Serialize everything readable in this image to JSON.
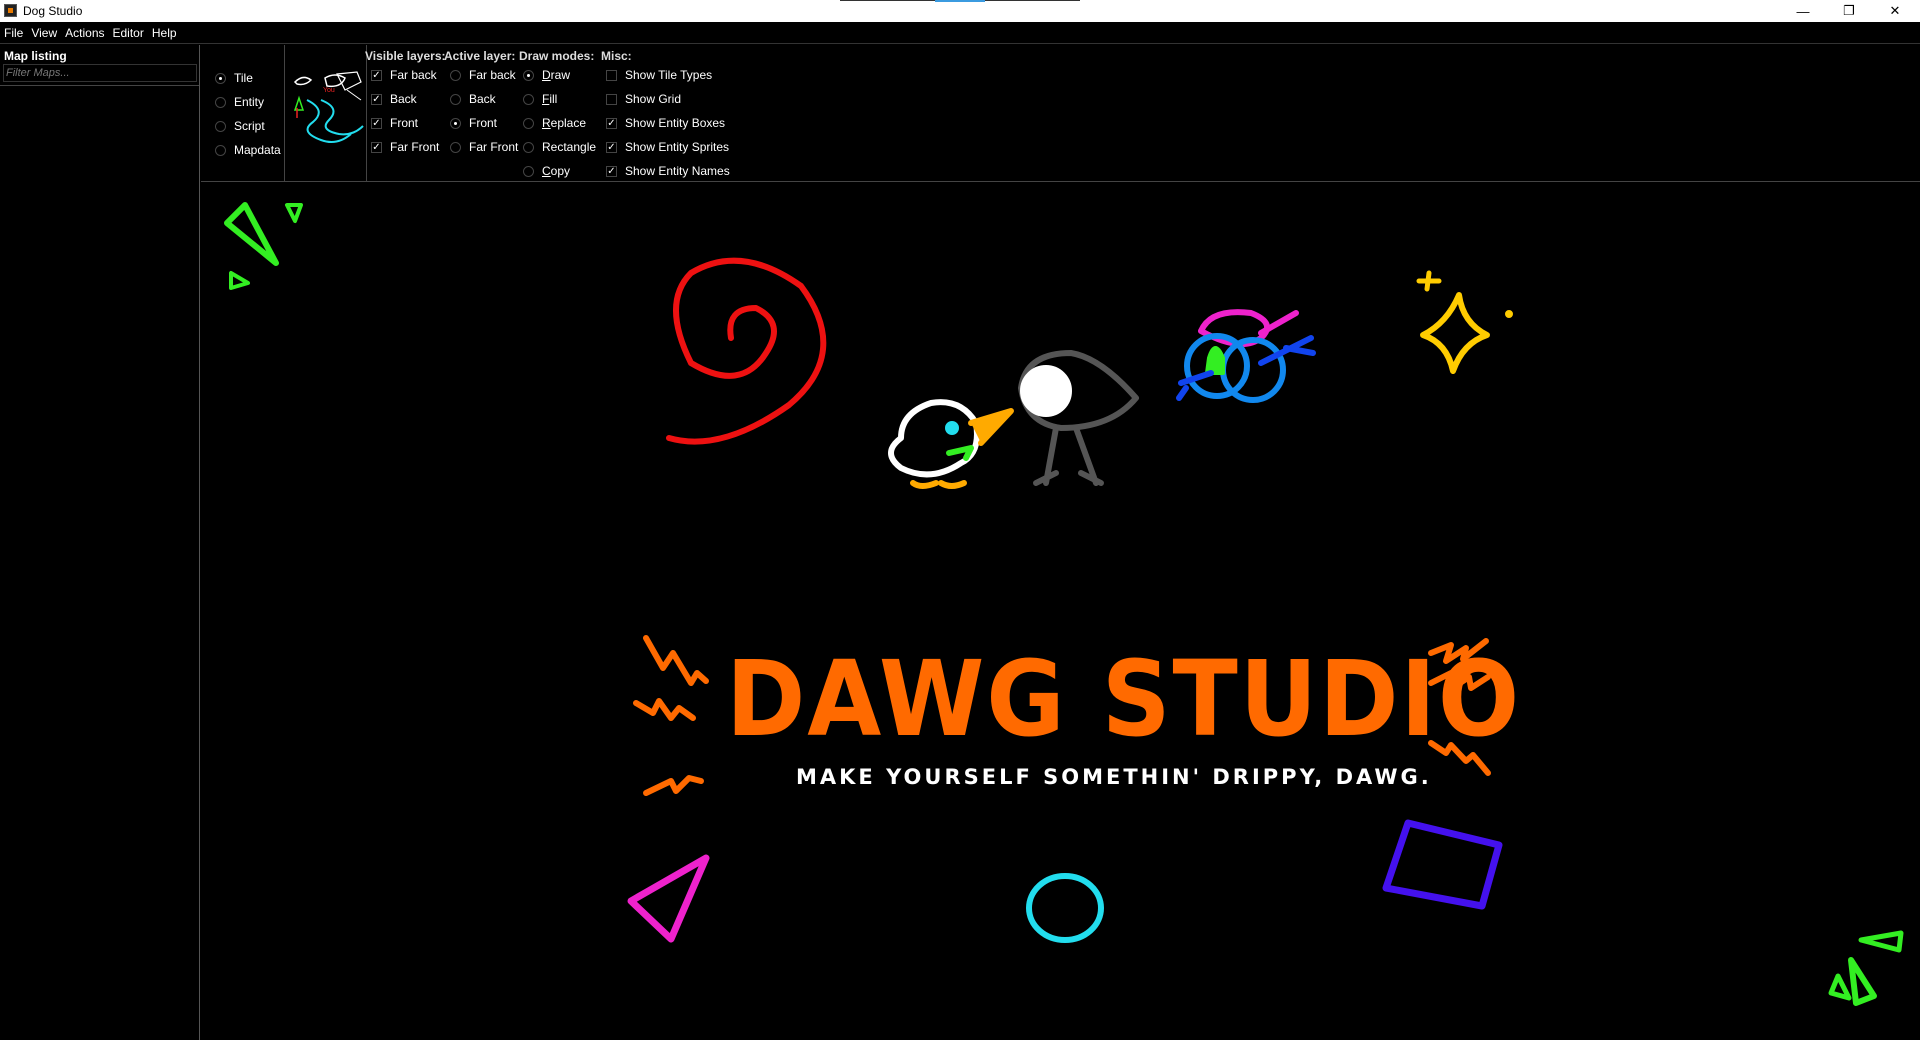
{
  "window": {
    "title": "Dog Studio",
    "icons": {
      "app": "app-icon",
      "minimize": "minimize-icon",
      "maximize": "restore-icon",
      "close": "close-icon"
    },
    "controls": {
      "minimize": "—",
      "maximize": "❐",
      "close": "✕"
    }
  },
  "menubar": {
    "items": [
      "File",
      "View",
      "Actions",
      "Editor",
      "Help"
    ]
  },
  "left_panel": {
    "title": "Map listing",
    "filter_placeholder": "Filter Maps..."
  },
  "toolbar": {
    "modes": [
      {
        "label": "Tile",
        "checked": true
      },
      {
        "label": "Entity",
        "checked": false
      },
      {
        "label": "Script",
        "checked": false
      },
      {
        "label": "Mapdata",
        "checked": false
      }
    ],
    "visible_layers": {
      "label": "Visible layers:",
      "items": [
        {
          "label": "Far back",
          "checked": true
        },
        {
          "label": "Back",
          "checked": true
        },
        {
          "label": "Front",
          "checked": true
        },
        {
          "label": "Far Front",
          "checked": true
        }
      ]
    },
    "active_layer": {
      "label": "Active layer:",
      "items": [
        {
          "label": "Far back",
          "checked": false
        },
        {
          "label": "Back",
          "checked": false
        },
        {
          "label": "Front",
          "checked": true
        },
        {
          "label": "Far Front",
          "checked": false
        }
      ]
    },
    "draw_modes": {
      "label": "Draw modes:",
      "items": [
        {
          "label": "Draw",
          "checked": true
        },
        {
          "label": "Fill",
          "checked": false
        },
        {
          "label": "Replace",
          "checked": false
        },
        {
          "label": "Rectangle",
          "checked": false
        },
        {
          "label": "Copy",
          "checked": false
        }
      ]
    },
    "misc": {
      "label": "Misc:",
      "items": [
        {
          "label": "Show Tile Types",
          "checked": false
        },
        {
          "label": "Show Grid",
          "checked": false
        },
        {
          "label": "Show Entity Boxes",
          "checked": true
        },
        {
          "label": "Show Entity Sprites",
          "checked": true
        },
        {
          "label": "Show Entity Names",
          "checked": true
        }
      ]
    },
    "check_mark": "✓"
  },
  "canvas": {
    "splash_title": "DAWG STUDIO",
    "splash_subtitle": "MAKE YOURSELF SOMETHIN' DRIPPY, DAWG.",
    "colors": {
      "orange": "#ff6a00",
      "green": "#33ee22",
      "red": "#ee1111",
      "yellow": "#ffcc00",
      "magenta": "#ee22cc",
      "cyan": "#22ddee",
      "indigo": "#4411ee",
      "blue": "#1188ee",
      "gray": "#555555"
    }
  }
}
